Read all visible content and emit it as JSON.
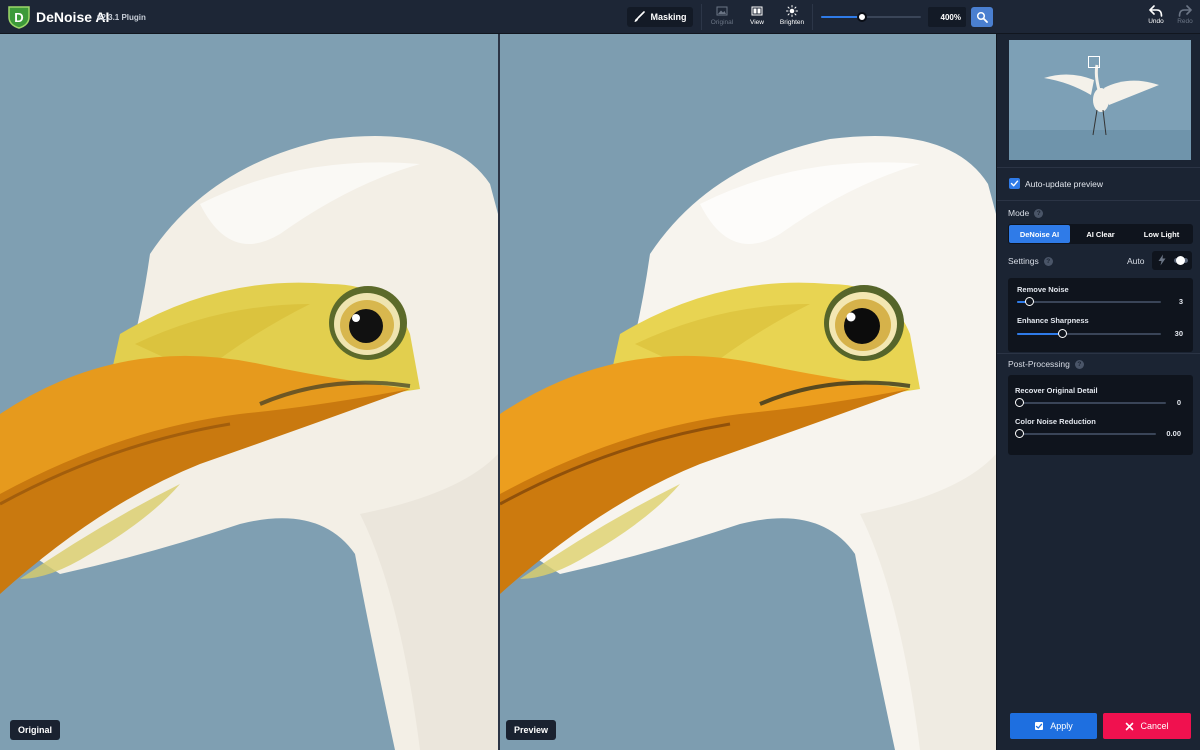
{
  "app": {
    "name": "DeNoise AI",
    "version": "v2.3.1 Plugin"
  },
  "toolbar": {
    "masking_label": "Masking",
    "original_label": "Original",
    "view_label": "View",
    "brighten_label": "Brighten",
    "zoom_value": "400%",
    "zoom_slider_fraction": 0.41,
    "undo_label": "Undo",
    "redo_label": "Redo"
  },
  "panes": {
    "original_label": "Original",
    "preview_label": "Preview"
  },
  "sidebar": {
    "auto_update_label": "Auto-update preview",
    "auto_update_checked": true,
    "mode_title": "Mode",
    "modes": [
      "DeNoise AI",
      "AI Clear",
      "Low Light"
    ],
    "active_mode": "DeNoise AI",
    "settings_title": "Settings",
    "auto_label": "Auto",
    "settings": [
      {
        "label": "Remove Noise",
        "value": "3",
        "fraction": 0.08
      },
      {
        "label": "Enhance Sharpness",
        "value": "30",
        "fraction": 0.31
      }
    ],
    "post_title": "Post-Processing",
    "post": [
      {
        "label": "Recover Original Detail",
        "value": "0",
        "fraction": 0.0
      },
      {
        "label": "Color Noise Reduction",
        "value": "0.00",
        "fraction": 0.0
      }
    ],
    "apply_label": "Apply",
    "cancel_label": "Cancel"
  },
  "colors": {
    "accent": "#2f7be8",
    "cancel": "#f0114f",
    "background": "#1b2433",
    "sky": "#7f9fb2"
  }
}
